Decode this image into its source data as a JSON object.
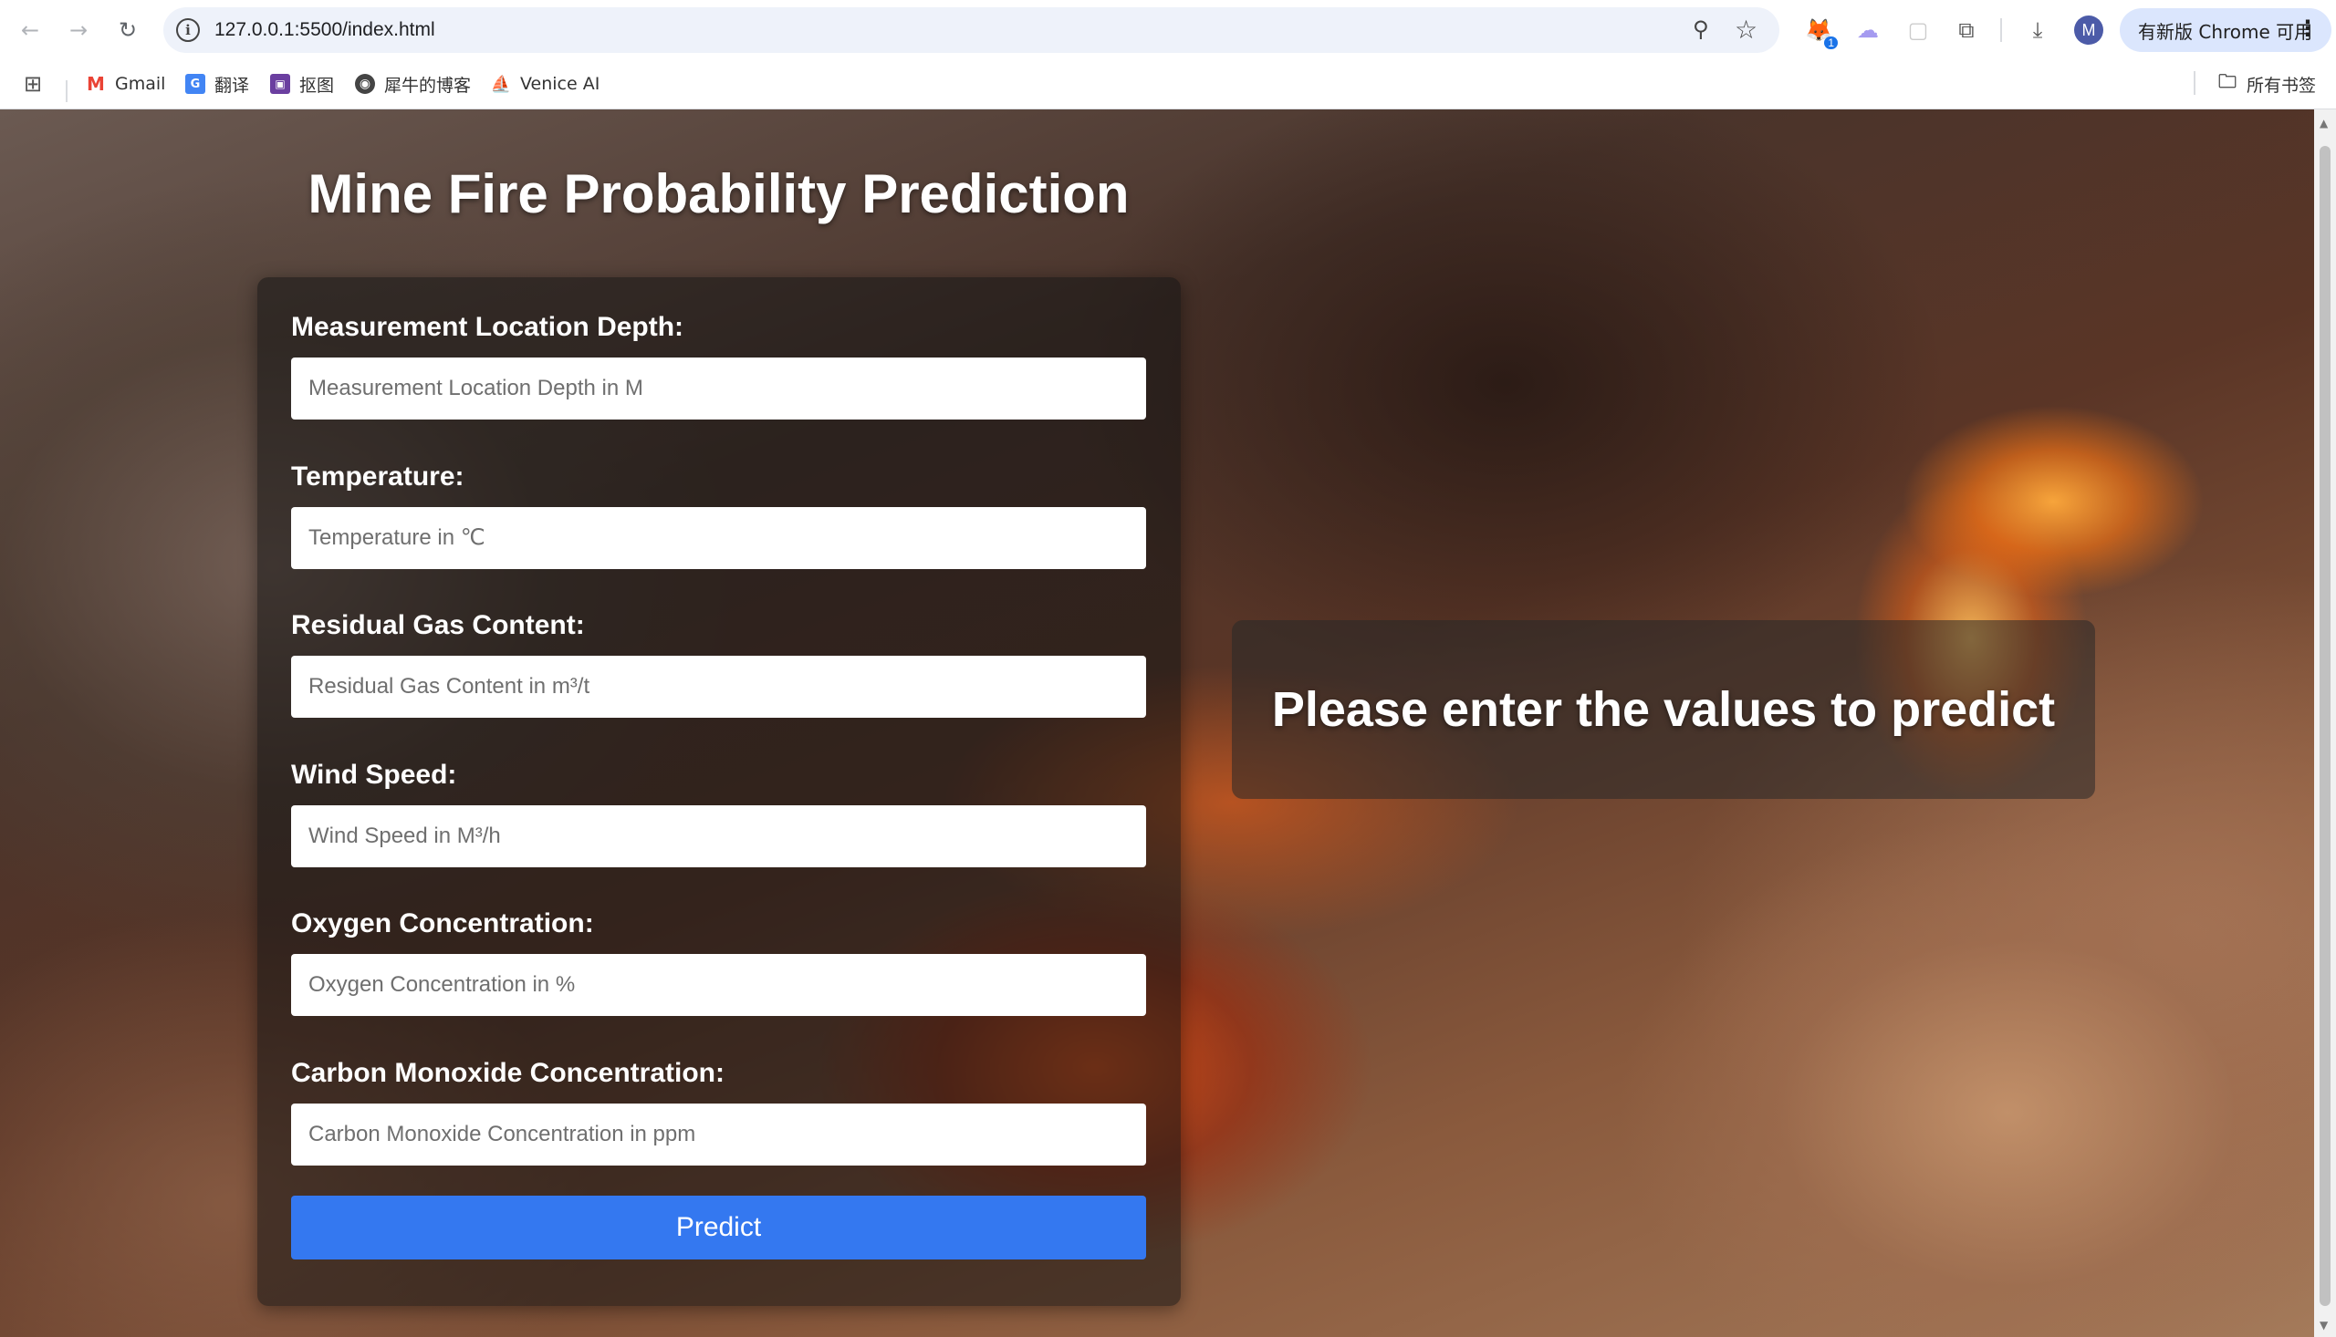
{
  "browser": {
    "url": "127.0.0.1:5500/index.html",
    "update_label": "有新版 Chrome 可用",
    "avatar_letter": "M",
    "extension_badge": "1"
  },
  "bookmarks": {
    "items": [
      {
        "label": "Gmail",
        "icon": "gmail-icon"
      },
      {
        "label": "翻译",
        "icon": "translate-icon"
      },
      {
        "label": "抠图",
        "icon": "cutout-icon"
      },
      {
        "label": "犀牛的博客",
        "icon": "globe-icon"
      },
      {
        "label": "Venice AI",
        "icon": "venice-icon"
      }
    ],
    "all_bookmarks_label": "所有书签"
  },
  "page": {
    "title": "Mine Fire Probability Prediction",
    "fields": [
      {
        "label": "Measurement Location Depth:",
        "placeholder": "Measurement Location Depth in M"
      },
      {
        "label": "Temperature:",
        "placeholder": "Temperature in ℃"
      },
      {
        "label": "Residual Gas Content:",
        "placeholder": "Residual Gas Content in m³/t"
      },
      {
        "label": "Wind Speed:",
        "placeholder": "Wind Speed in M³/h"
      },
      {
        "label": "Oxygen Concentration:",
        "placeholder": "Oxygen Concentration in %"
      },
      {
        "label": "Carbon Monoxide Concentration:",
        "placeholder": "Carbon Monoxide Concentration in ppm"
      }
    ],
    "predict_label": "Predict",
    "result_text": "Please enter the values to predict"
  }
}
